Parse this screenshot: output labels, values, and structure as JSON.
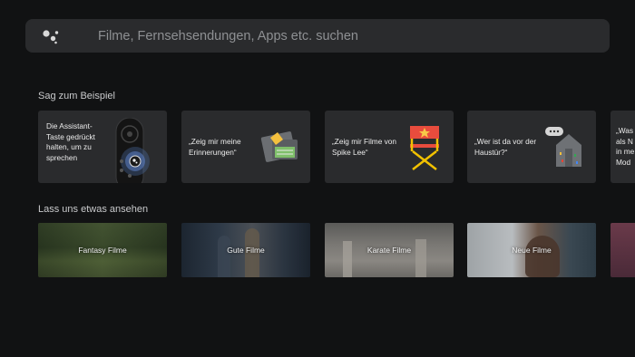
{
  "search": {
    "placeholder": "Filme, Fernsehsendungen, Apps etc. suchen"
  },
  "suggestions": {
    "title": "Sag zum Beispiel",
    "items": [
      {
        "text": "Die Assistant-Taste gedrückt halten, um zu sprechen",
        "icon": "remote-control-icon"
      },
      {
        "text": "„Zeig mir meine Erinnerungen“",
        "icon": "photos-icon"
      },
      {
        "text": "„Zeig mir Filme von Spike Lee“",
        "icon": "director-chair-icon"
      },
      {
        "text": "„Wer ist da vor der Haustür?“",
        "icon": "doorbell-house-icon"
      },
      {
        "text": "„Was als N in me Mod",
        "icon": ""
      }
    ]
  },
  "watch": {
    "title": "Lass uns etwas ansehen",
    "items": [
      {
        "label": "Fantasy Filme"
      },
      {
        "label": "Gute Filme"
      },
      {
        "label": "Karate Filme"
      },
      {
        "label": "Neue Filme"
      },
      {
        "label": ""
      }
    ]
  },
  "colors": {
    "background": "#111213",
    "card": "#2a2b2d",
    "assistant_blue": "#4285f4",
    "assistant_red": "#ea4335",
    "assistant_yellow": "#fbbc04",
    "assistant_green": "#34a853"
  }
}
